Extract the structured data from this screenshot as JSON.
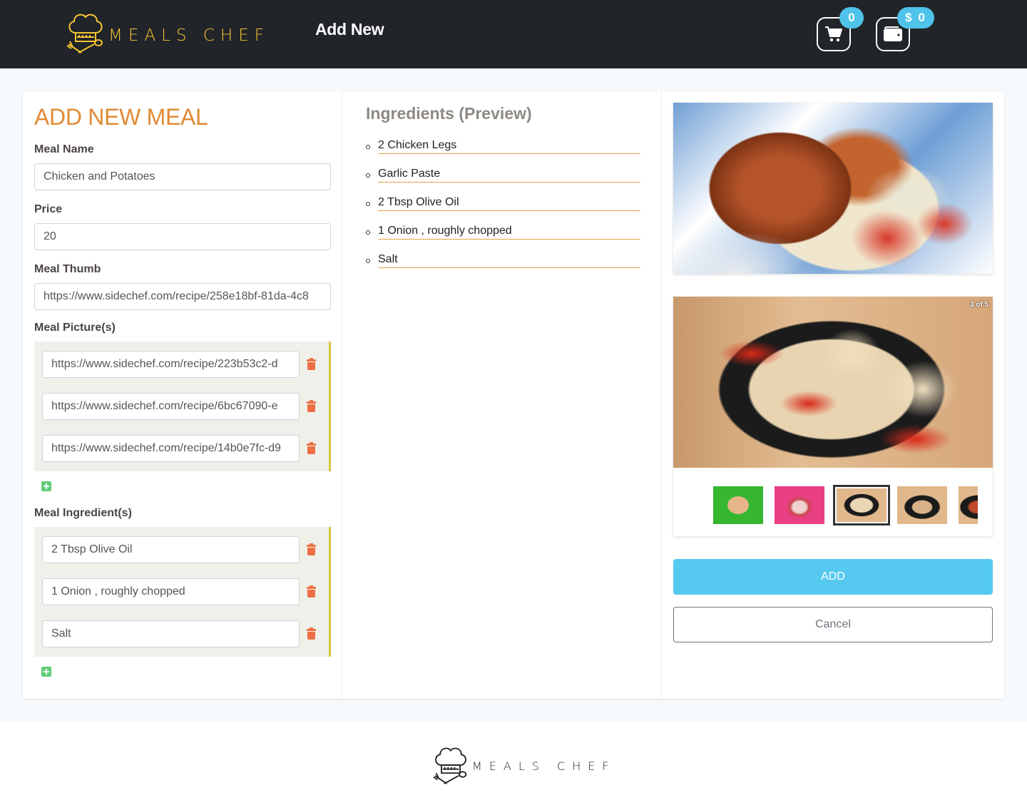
{
  "header": {
    "brand": "MEALS CHEF",
    "nav_add_new": "Add New",
    "cart_count": "0",
    "wallet_balance": "$ 0",
    "accent_color": "#f4c430",
    "badge_color": "#4fc3ea"
  },
  "form": {
    "title": "ADD NEW MEAL",
    "meal_name": {
      "label": "Meal Name",
      "value": "Chicken and Potatoes"
    },
    "price": {
      "label": "Price",
      "value": "20"
    },
    "meal_thumb": {
      "label": "Meal Thumb",
      "value": "https://www.sidechef.com/recipe/258e18bf-81da-4c8"
    },
    "pictures": {
      "label": "Meal Picture(s)",
      "items": [
        "https://www.sidechef.com/recipe/223b53c2-d",
        "https://www.sidechef.com/recipe/6bc67090-e",
        "https://www.sidechef.com/recipe/14b0e7fc-d9"
      ]
    },
    "ingredients": {
      "label": "Meal Ingredient(s)",
      "items": [
        "2 Tbsp Olive Oil",
        "1 Onion , roughly chopped",
        "Salt"
      ]
    }
  },
  "preview": {
    "title": "Ingredients (Preview)",
    "items": [
      "2 Chicken Legs",
      "Garlic Paste",
      "2 Tbsp Olive Oil",
      "1 Onion , roughly chopped",
      "Salt"
    ]
  },
  "gallery": {
    "counter": "3 of 5",
    "current_index": 3,
    "total": 5
  },
  "actions": {
    "add_label": "ADD",
    "cancel_label": "Cancel",
    "add_color": "#55c9f0"
  },
  "footer": {
    "brand": "MEALS CHEF"
  }
}
